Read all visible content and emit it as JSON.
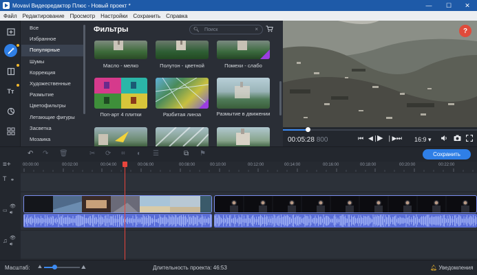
{
  "window": {
    "title": "Movavi Видеоредактор Плюс - Новый проект *",
    "minimize": "—",
    "maximize": "☐",
    "close": "✕"
  },
  "menu": [
    "Файл",
    "Редактирование",
    "Просмотр",
    "Настройки",
    "Сохранить",
    "Справка"
  ],
  "categories": [
    "Все",
    "Избранное",
    "Популярные",
    "Шумы",
    "Коррекция",
    "Художественные",
    "Размытие",
    "Цветофильтры",
    "Летающие фигуры",
    "Засветка",
    "Мозаика"
  ],
  "selected_category": "Популярные",
  "filters_panel": {
    "title": "Фильтры",
    "search_placeholder": "Поиск",
    "items": [
      "Масло - мелко",
      "Полутон - цветной",
      "Помехи - слабо",
      "Поп-арт 4 плитки",
      "Разбитая линза",
      "Размытие в движении",
      "",
      "",
      ""
    ]
  },
  "player": {
    "time": "00:05:28",
    "frames": "800",
    "ratio": "16:9",
    "help": "?"
  },
  "toolbar": {
    "save_label": "Сохранить"
  },
  "ruler_ticks": [
    "00:00:00",
    "00:02:00",
    "00:04:00",
    "00:06:00",
    "00:08:00",
    "00:10:00",
    "00:12:00",
    "00:14:00",
    "00:16:00",
    "00:18:00",
    "00:20:00",
    "00:22:00"
  ],
  "status": {
    "scale_label": "Масштаб:",
    "duration_label": "Длительность проекта: 46:53",
    "notifications": "Уведомления"
  },
  "colors": {
    "accent": "#2f7fe6",
    "playhead": "#e8453c",
    "clip_border": "#7c8ff0",
    "audio": "#5a6ed8",
    "titlebar": "#1e5aa8"
  }
}
